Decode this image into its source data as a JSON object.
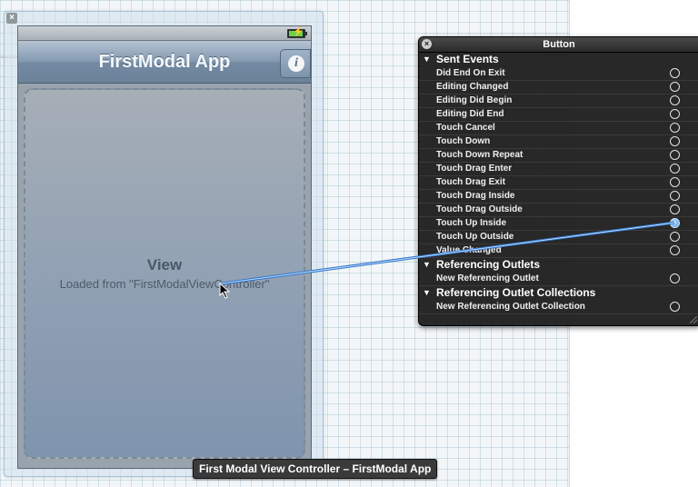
{
  "canvas": {
    "view_controller_label": "First Modal View Controller – FirstModal App"
  },
  "phone": {
    "nav_title": "FirstModal App",
    "info_button": "i",
    "view_title": "View",
    "view_subtitle": "Loaded from \"FirstModalViewController\""
  },
  "hud": {
    "title": "Button",
    "sections": [
      {
        "title": "Sent Events",
        "items": [
          {
            "label": "Did End On Exit",
            "connected": false
          },
          {
            "label": "Editing Changed",
            "connected": false
          },
          {
            "label": "Editing Did Begin",
            "connected": false
          },
          {
            "label": "Editing Did End",
            "connected": false
          },
          {
            "label": "Touch Cancel",
            "connected": false
          },
          {
            "label": "Touch Down",
            "connected": false
          },
          {
            "label": "Touch Down Repeat",
            "connected": false
          },
          {
            "label": "Touch Drag Enter",
            "connected": false
          },
          {
            "label": "Touch Drag Exit",
            "connected": false
          },
          {
            "label": "Touch Drag Inside",
            "connected": false
          },
          {
            "label": "Touch Drag Outside",
            "connected": false
          },
          {
            "label": "Touch Up Inside",
            "connected": true
          },
          {
            "label": "Touch Up Outside",
            "connected": false
          },
          {
            "label": "Value Changed",
            "connected": false
          }
        ]
      },
      {
        "title": "Referencing Outlets",
        "items": [
          {
            "label": "New Referencing Outlet",
            "connected": false
          }
        ]
      },
      {
        "title": "Referencing Outlet Collections",
        "items": [
          {
            "label": "New Referencing Outlet Collection",
            "connected": false
          }
        ]
      }
    ]
  },
  "colors": {
    "connection_line": "#4a90d9",
    "hud_background": "#181818"
  }
}
